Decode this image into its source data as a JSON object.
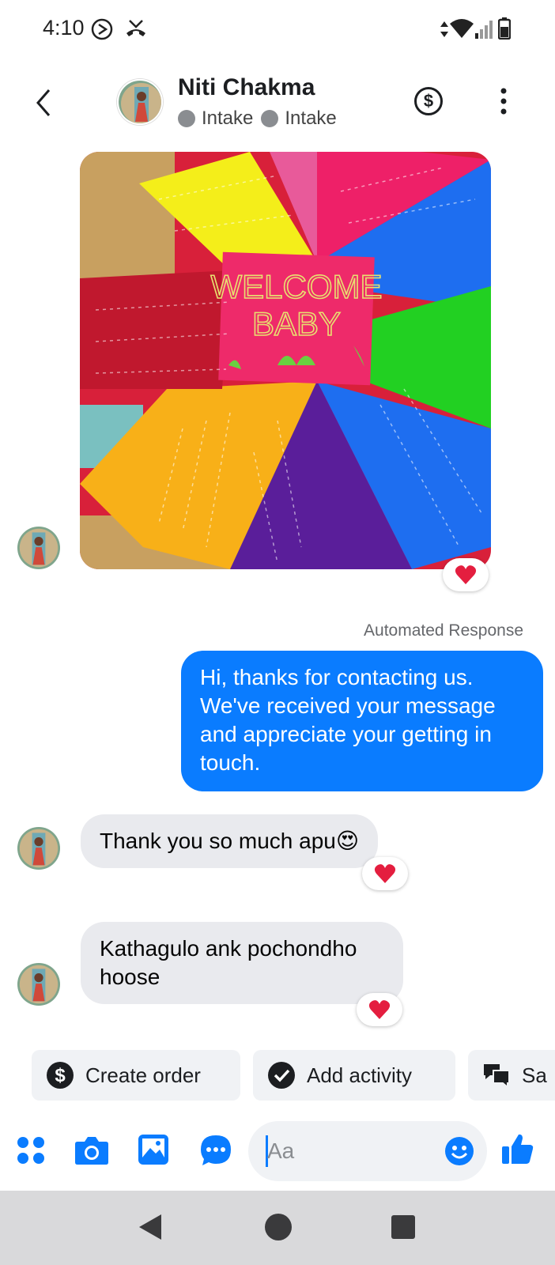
{
  "status_bar": {
    "time": "4:10"
  },
  "header": {
    "contact_name": "Niti Chakma",
    "labels": [
      "Intake",
      "Intake"
    ]
  },
  "image_message": {
    "embroidery_text_line1": "WELCOME",
    "embroidery_text_line2": "BABY"
  },
  "messages": [
    {
      "sender": "contact",
      "type": "image",
      "reaction": "heart"
    },
    {
      "sender": "page",
      "meta": "Automated Response",
      "text": "Hi, thanks for contacting us. We've received your message and appreciate your getting in touch."
    },
    {
      "sender": "contact",
      "text": "Thank you so much apu😍",
      "reaction": "heart"
    },
    {
      "sender": "contact",
      "text": "Kathagulo ank pochondho hoose",
      "reaction": "heart"
    }
  ],
  "quick_actions": [
    {
      "label": "Create order",
      "icon": "dollar-circle-icon"
    },
    {
      "label": "Add activity",
      "icon": "check-circle-icon"
    },
    {
      "label": "Sa",
      "icon": "chat-bubbles-icon"
    }
  ],
  "composer": {
    "placeholder": "Aa"
  },
  "colors": {
    "accent": "#0a7cff",
    "incoming_bubble": "#e9eaee",
    "heart": "#e41e3f"
  }
}
